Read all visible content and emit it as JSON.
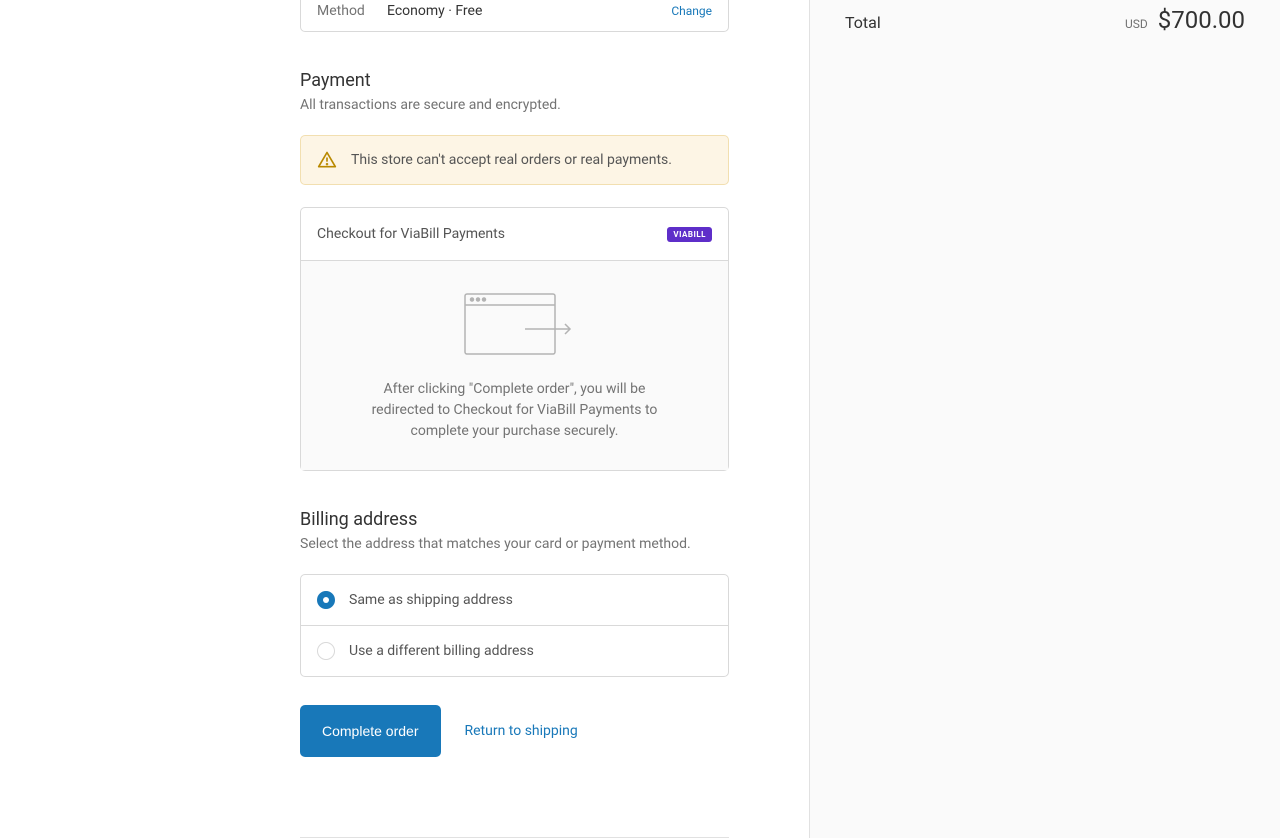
{
  "shipping": {
    "method_label": "Method",
    "method_value": "Economy · Free",
    "change_label": "Change"
  },
  "payment": {
    "title": "Payment",
    "subtitle": "All transactions are secure and encrypted.",
    "warning": "This store can't accept real orders or real payments.",
    "method_name": "Checkout for ViaBill Payments",
    "badge_text": "VIABILL",
    "redirect_text": "After clicking \"Complete order\", you will be redirected to Checkout for ViaBill Payments to complete your purchase securely."
  },
  "billing": {
    "title": "Billing address",
    "subtitle": "Select the address that matches your card or payment method.",
    "options": [
      {
        "label": "Same as shipping address",
        "selected": true
      },
      {
        "label": "Use a different billing address",
        "selected": false
      }
    ]
  },
  "actions": {
    "complete": "Complete order",
    "return": "Return to shipping"
  },
  "summary": {
    "total_label": "Total",
    "currency": "USD",
    "amount": "$700.00"
  }
}
